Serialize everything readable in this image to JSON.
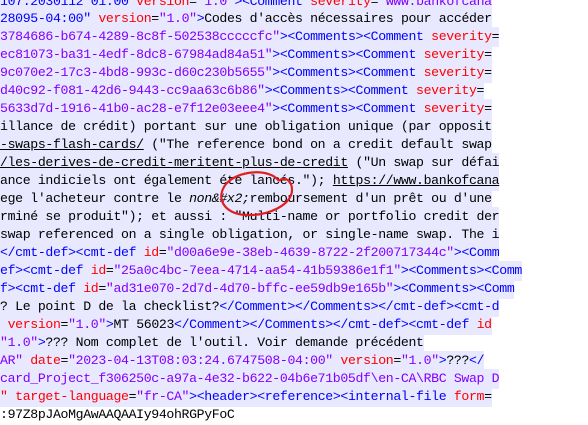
{
  "lines": [
    {
      "highlighted": true,
      "segments": [
        {
          "c": "t",
          "t": "107.2030112 01:00 "
        },
        {
          "c": "a",
          "t": "version"
        },
        {
          "c": "x",
          "t": "="
        },
        {
          "c": "v",
          "t": "\"1.0\""
        },
        {
          "c": "t",
          "t": "><Comment"
        },
        {
          "c": "a",
          "t": " severity"
        },
        {
          "c": "x",
          "t": "="
        },
        {
          "c": "v",
          "t": "\"www.bankofcana"
        }
      ]
    },
    {
      "highlighted": true,
      "segments": [
        {
          "c": "t",
          "t": "28095-04:00\" "
        },
        {
          "c": "a",
          "t": "version"
        },
        {
          "c": "x",
          "t": "="
        },
        {
          "c": "v",
          "t": "\"1.0\""
        },
        {
          "c": "t",
          "t": ">"
        },
        {
          "c": "x",
          "t": "Codes d'accès nécessaires pour accéder"
        }
      ]
    },
    {
      "highlighted": true,
      "segments": [
        {
          "c": "v",
          "t": "3784686-b674-4289-8c8f-502538cccccfc\""
        },
        {
          "c": "t",
          "t": "><Comments><Comment"
        },
        {
          "c": "a",
          "t": " severity"
        },
        {
          "c": "x",
          "t": "="
        }
      ]
    },
    {
      "highlighted": true,
      "segments": [
        {
          "c": "v",
          "t": "ec81073-ba31-4edf-8dc8-67984ad84a51\""
        },
        {
          "c": "t",
          "t": "><Comments><Comment"
        },
        {
          "c": "a",
          "t": " severity"
        },
        {
          "c": "x",
          "t": "="
        }
      ]
    },
    {
      "highlighted": true,
      "segments": [
        {
          "c": "v",
          "t": "9c070e2-17c3-4bd8-993c-d60c230b5655\""
        },
        {
          "c": "t",
          "t": "><Comments><Comment"
        },
        {
          "c": "a",
          "t": " severity"
        },
        {
          "c": "x",
          "t": "="
        }
      ]
    },
    {
      "highlighted": true,
      "segments": [
        {
          "c": "v",
          "t": "d40c92-f081-42d6-9443-cc9aa63c6b86\""
        },
        {
          "c": "t",
          "t": "><Comments><Comment"
        },
        {
          "c": "a",
          "t": " severity"
        },
        {
          "c": "x",
          "t": "="
        }
      ]
    },
    {
      "highlighted": true,
      "segments": [
        {
          "c": "v",
          "t": "5633d7d-1916-41b0-ac28-e7f12e03eee4\""
        },
        {
          "c": "t",
          "t": "><Comments><Comment"
        },
        {
          "c": "a",
          "t": " severity"
        },
        {
          "c": "x",
          "t": "="
        }
      ]
    },
    {
      "highlighted": true,
      "segments": [
        {
          "c": "x",
          "t": "illance de crédit) portant sur une obligation unique (par opposit"
        }
      ]
    },
    {
      "highlighted": true,
      "segments": [
        {
          "c": "x",
          "t": "-swaps-flash-cards/",
          "u": true
        },
        {
          "c": "x",
          "t": " (\"The reference bond on a credit default swap"
        }
      ]
    },
    {
      "highlighted": true,
      "segments": [
        {
          "c": "x",
          "t": "/les-derives-de-credit-meritent-plus-de-credit",
          "u": true
        },
        {
          "c": "x",
          "t": " (\"Un swap sur défai"
        }
      ]
    },
    {
      "highlighted": true,
      "segments": [
        {
          "c": "x",
          "t": "ance indiciels ont également été lancés.\"); "
        },
        {
          "c": "x",
          "t": "https://www.bankofcana",
          "u": true
        }
      ]
    },
    {
      "highlighted": true,
      "segments": [
        {
          "c": "x",
          "t": "ege l'acheteur contre le "
        },
        {
          "c": "x",
          "t": "non&#x2;",
          "i": true
        },
        {
          "c": "x",
          "t": "remboursement d'un prêt ou d'une"
        }
      ]
    },
    {
      "highlighted": true,
      "segments": [
        {
          "c": "x",
          "t": "rminé se produit\"); et aussi : \"Multi-name or portfolio credit der"
        }
      ]
    },
    {
      "highlighted": true,
      "segments": [
        {
          "c": "x",
          "t": "swap referenced on a single obligation, or single-name swap. The i"
        }
      ]
    },
    {
      "highlighted": true,
      "segments": [
        {
          "c": "t",
          "t": "</cmt-def><cmt-def "
        },
        {
          "c": "a",
          "t": "id"
        },
        {
          "c": "x",
          "t": "="
        },
        {
          "c": "v",
          "t": "\"d00a6e9e-38eb-4639-8722-2f200717344c\""
        },
        {
          "c": "t",
          "t": "><Comm"
        }
      ]
    },
    {
      "highlighted": true,
      "segments": [
        {
          "c": "t",
          "t": "ef><cmt-def "
        },
        {
          "c": "a",
          "t": "id"
        },
        {
          "c": "x",
          "t": "="
        },
        {
          "c": "v",
          "t": "\"25a0c4bc-7eea-4714-aa54-41b59386e1f1\""
        },
        {
          "c": "t",
          "t": "><Comments><Comm"
        }
      ]
    },
    {
      "highlighted": true,
      "segments": [
        {
          "c": "t",
          "t": "f><cmt-def "
        },
        {
          "c": "a",
          "t": "id"
        },
        {
          "c": "x",
          "t": "="
        },
        {
          "c": "v",
          "t": "\"ad31e070-2d7d-4d70-bffc-ee59db9e165b\""
        },
        {
          "c": "t",
          "t": "><Comments><Comm"
        }
      ]
    },
    {
      "highlighted": true,
      "segments": [
        {
          "c": "x",
          "t": "? Le point D de la checklist?"
        },
        {
          "c": "t",
          "t": "</Comment></Comments></cmt-def><cmt-d"
        }
      ]
    },
    {
      "highlighted": true,
      "segments": [
        {
          "c": "a",
          "t": " version"
        },
        {
          "c": "x",
          "t": "="
        },
        {
          "c": "v",
          "t": "\"1.0\""
        },
        {
          "c": "t",
          "t": ">"
        },
        {
          "c": "x",
          "t": "MT 56023"
        },
        {
          "c": "t",
          "t": "</Comment></Comments></cmt-def><cmt-def "
        },
        {
          "c": "a",
          "t": "id"
        }
      ]
    },
    {
      "highlighted": true,
      "segments": [
        {
          "c": "v",
          "t": "\"1.0\""
        },
        {
          "c": "t",
          "t": ">"
        },
        {
          "c": "x",
          "t": "??? Nom complet de l'outil. Voir demande précédent"
        }
      ]
    },
    {
      "highlighted": true,
      "segments": [
        {
          "c": "v",
          "t": "AR\""
        },
        {
          "c": "a",
          "t": " date"
        },
        {
          "c": "x",
          "t": "="
        },
        {
          "c": "v",
          "t": "\"2023-04-13T08:03:24.6747508-04:00\""
        },
        {
          "c": "a",
          "t": " version"
        },
        {
          "c": "x",
          "t": "="
        },
        {
          "c": "v",
          "t": "\"1.0\""
        },
        {
          "c": "t",
          "t": ">"
        },
        {
          "c": "x",
          "t": "???"
        },
        {
          "c": "t",
          "t": "</"
        }
      ]
    },
    {
      "highlighted": true,
      "segments": [
        {
          "c": "v",
          "t": "card_Project_f306250c-a97a-4e32-b622-04b6e71b05df\\en-CA\\RBC Swap D"
        }
      ]
    },
    {
      "highlighted": true,
      "segments": [
        {
          "c": "a",
          "t": "\" target-language"
        },
        {
          "c": "x",
          "t": "="
        },
        {
          "c": "v",
          "t": "\"fr-CA\""
        },
        {
          "c": "t",
          "t": "><header><reference><internal-file"
        },
        {
          "c": "a",
          "t": " form"
        },
        {
          "c": "x",
          "t": "="
        }
      ]
    },
    {
      "highlighted": false,
      "segments": [
        {
          "c": "x",
          "t": ":97Z8pJAoMgAwAAQAAIy94ohRGPyFoC"
        }
      ]
    }
  ]
}
